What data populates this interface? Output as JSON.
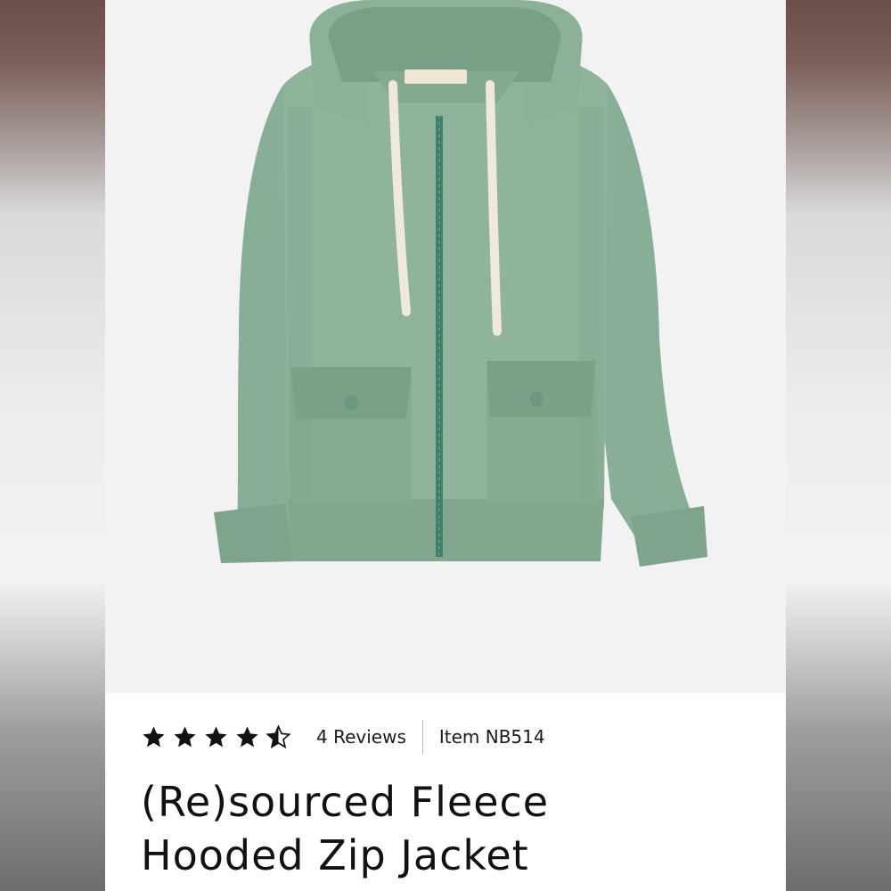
{
  "product": {
    "image_alt": "green sherpa fleece hooded zip jacket with drawstrings and snap flap pockets",
    "rating": {
      "stars": 4.5,
      "max": 5
    },
    "reviews_label": "4 Reviews",
    "item_number": "Item NB514",
    "title_line1": "(Re)sourced Fleece",
    "title_line2": "Hooded Zip Jacket"
  },
  "colors": {
    "jacket_body": "#8fb39b",
    "jacket_shadow": "#7a9f87",
    "nylon_panel": "#86ab93",
    "zipper": "#3f7f6d",
    "drawstring": "#efe8dc",
    "star": "#111111"
  }
}
